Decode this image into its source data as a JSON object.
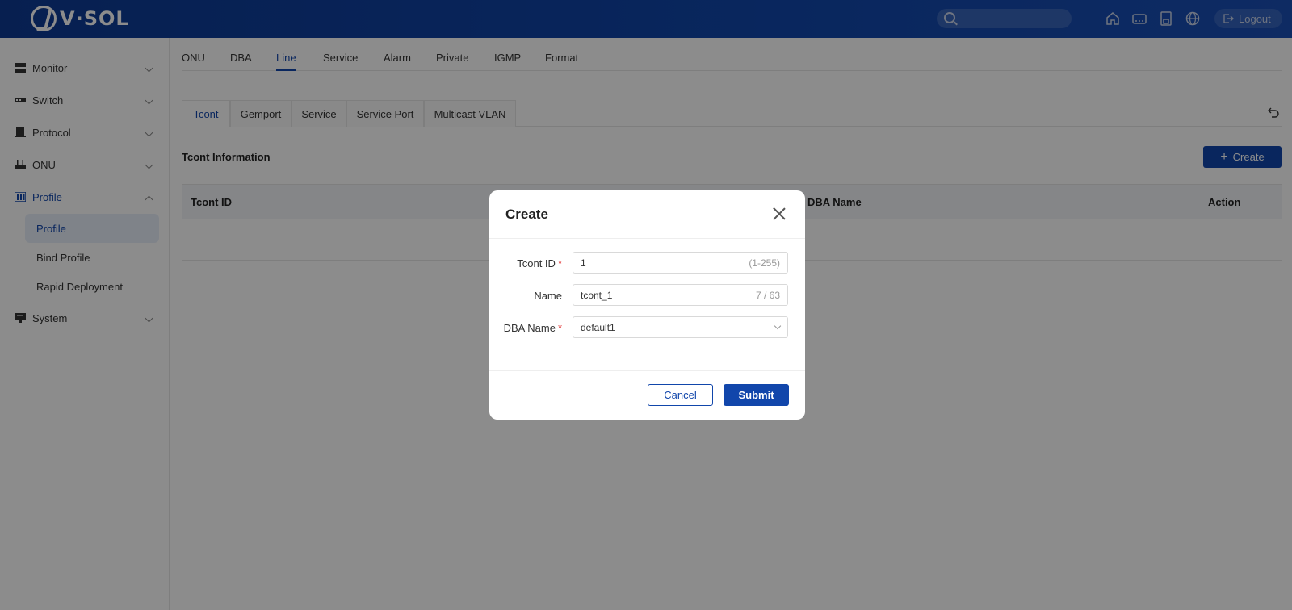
{
  "header": {
    "brand": "V·SOL",
    "search_placeholder": "",
    "icons": [
      "home-icon",
      "device-icon",
      "save-icon",
      "globe-icon"
    ],
    "logout_label": "Logout"
  },
  "sidebar": {
    "items": [
      {
        "label": "Monitor",
        "icon": "monitor-icon"
      },
      {
        "label": "Switch",
        "icon": "switch-icon"
      },
      {
        "label": "Protocol",
        "icon": "protocol-icon"
      },
      {
        "label": "ONU",
        "icon": "onu-icon"
      },
      {
        "label": "Profile",
        "icon": "profile-icon",
        "expanded": true
      },
      {
        "label": "System",
        "icon": "system-icon"
      }
    ],
    "sub_items": [
      {
        "label": "Profile",
        "active": true
      },
      {
        "label": "Bind Profile"
      },
      {
        "label": "Rapid Deployment"
      }
    ]
  },
  "top_tabs": [
    "ONU",
    "DBA",
    "Line",
    "Service",
    "Alarm",
    "Private",
    "IGMP",
    "Format"
  ],
  "top_tab_active": "Line",
  "sub_tabs": [
    "Tcont",
    "Gemport",
    "Service",
    "Service Port",
    "Multicast VLAN"
  ],
  "sub_tab_active": "Tcont",
  "section": {
    "title": "Tcont Information",
    "create_label": "Create"
  },
  "table": {
    "headers": [
      "Tcont ID",
      "DBA Name",
      "Action"
    ]
  },
  "modal": {
    "title": "Create",
    "fields": {
      "tcont_id": {
        "label": "Tcont ID",
        "required": "*",
        "value": "1",
        "hint": "(1-255)"
      },
      "name": {
        "label": "Name",
        "value": "tcont_1",
        "hint": "7 / 63"
      },
      "dba_name": {
        "label": "DBA Name",
        "required": "*",
        "value": "default1"
      }
    },
    "cancel_label": "Cancel",
    "submit_label": "Submit"
  },
  "colors": {
    "brand": "#1146ab",
    "required": "#e23b3b"
  }
}
